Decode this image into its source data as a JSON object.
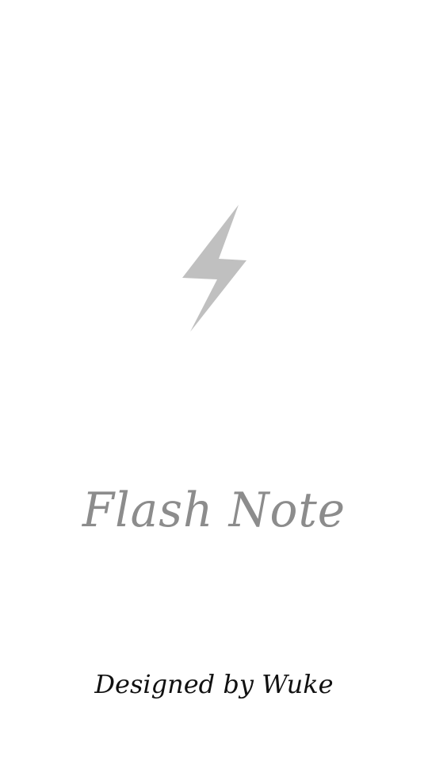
{
  "splash": {
    "logo_icon": "lightning-bolt-icon",
    "logo_color": "#c0c0c0",
    "app_title": "Flash Note",
    "title_color": "#8c8c8c",
    "credit": "Designed by Wuke",
    "credit_color": "#111111",
    "background": "#ffffff"
  }
}
